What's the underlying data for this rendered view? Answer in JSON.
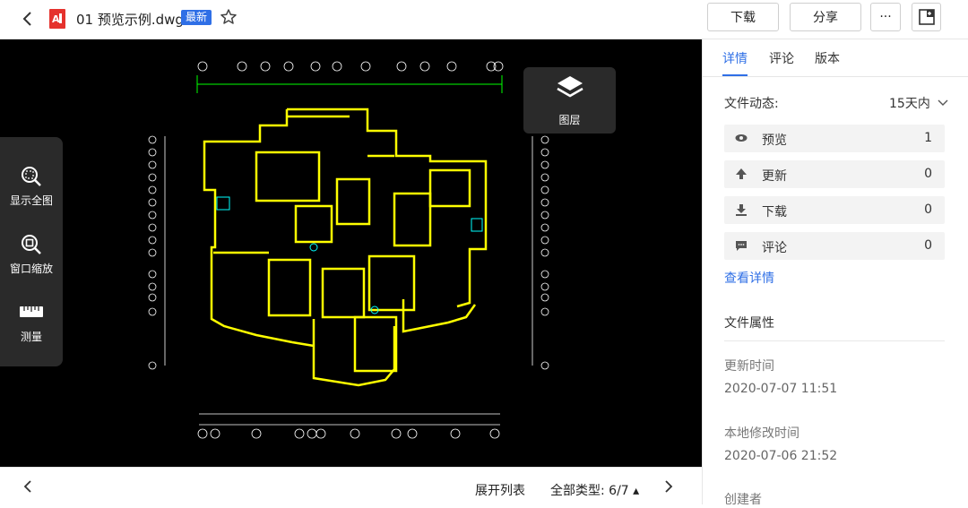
{
  "header": {
    "title": "01 预览示例.dwg",
    "badge": "最新",
    "download_label": "下载",
    "share_label": "分享",
    "more_label": "···"
  },
  "viewer": {
    "layers_label": "图层",
    "tools": [
      {
        "label": "显示全图",
        "icon": "fit-screen-icon"
      },
      {
        "label": "窗口缩放",
        "icon": "window-zoom-icon"
      },
      {
        "label": "测量",
        "icon": "ruler-icon"
      }
    ]
  },
  "bottom": {
    "list_label": "展开列表",
    "types_label": "全部类型: 6/7 ▴"
  },
  "side": {
    "tabs": [
      "详情",
      "评论",
      "版本"
    ],
    "activity_title": "文件动态:",
    "range": "15天内",
    "stats": [
      {
        "label": "预览",
        "value": "1",
        "icon": "eye-icon"
      },
      {
        "label": "更新",
        "value": "0",
        "icon": "arrow-up-icon"
      },
      {
        "label": "下载",
        "value": "0",
        "icon": "download-icon"
      },
      {
        "label": "评论",
        "value": "0",
        "icon": "comment-icon"
      }
    ],
    "detail_link": "查看详情",
    "props_title": "文件属性",
    "props": [
      {
        "label": "更新时间",
        "value": "2020-07-07 11:51"
      },
      {
        "label": "本地修改时间",
        "value": "2020-07-06 21:52"
      },
      {
        "label": "创建者",
        "value": ""
      }
    ]
  },
  "colors": {
    "accent": "#2f6fe6",
    "cad_wall": "#ffff00",
    "cad_dim": "#00ff00",
    "cad_grid": "#ffffff",
    "cad_fixture": "#00ffff"
  }
}
